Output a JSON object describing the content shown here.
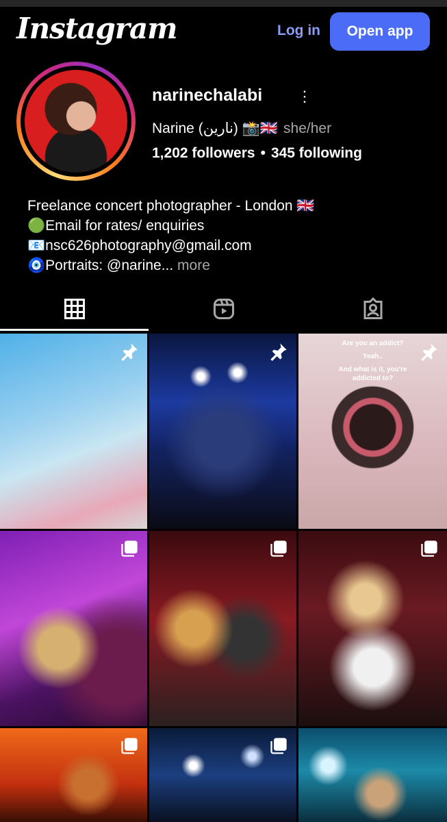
{
  "header": {
    "logo_text": "Instagram",
    "login_label": "Log in",
    "open_app_label": "Open app"
  },
  "profile": {
    "username": "narinechalabi",
    "more_icon": "more-vertical-icon",
    "full_name": "Narine (نارين) 📸🇬🇧",
    "pronouns": "she/her",
    "followers": "1,202 followers",
    "separator": "•",
    "following": "345 following"
  },
  "bio": {
    "lines": [
      "Freelance concert photographer - London 🇬🇧",
      "🟢Email for rates/ enquiries",
      "📧nsc626photography@gmail.com",
      "🧿Portraits: @narine..."
    ],
    "more_label": " more"
  },
  "tabs": [
    {
      "name": "posts",
      "icon": "grid-icon",
      "active": true
    },
    {
      "name": "reels",
      "icon": "reels-icon",
      "active": false
    },
    {
      "name": "tagged",
      "icon": "tagged-icon",
      "active": false
    }
  ],
  "posts": [
    {
      "badge": "pin-icon"
    },
    {
      "badge": "pin-icon"
    },
    {
      "badge": "pin-icon",
      "caption": [
        "Are you an addict?",
        "Yeah..",
        "And what is it, you're addicted to?"
      ]
    },
    {
      "badge": "carousel-icon"
    },
    {
      "badge": "carousel-icon"
    },
    {
      "badge": "carousel-icon"
    },
    {
      "badge": "carousel-icon"
    },
    {
      "badge": "carousel-icon"
    },
    {
      "badge": "none"
    }
  ],
  "colors": {
    "accent_button": "#4a6cf7",
    "login_text": "#8c9cf6",
    "muted_text": "#a8a8a8",
    "background": "#000000"
  }
}
